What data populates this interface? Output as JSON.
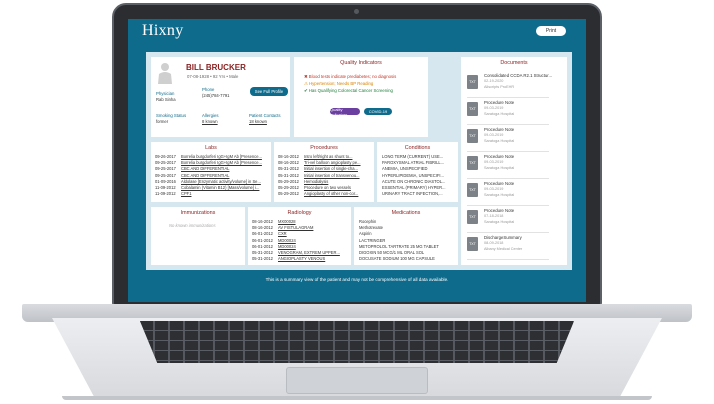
{
  "app": {
    "logo": "Hixny",
    "print_label": "Print"
  },
  "patient": {
    "name": "BILL BRUCKER",
    "meta": "07-08-1928 • 92 Yrs • Male",
    "physician_label": "Physician",
    "physician": "Rab Sinha",
    "phone_label": "Phone",
    "phone": "(245)784-7791",
    "full_profile_label": "See Full Profile",
    "smoking_label": "Smoking Status",
    "smoking": "former",
    "allergies_label": "Allergies",
    "allergies": "8 known",
    "contacts_label": "Patient Contacts",
    "contacts": "18 known"
  },
  "quality": {
    "title": "Quality Indicators",
    "items": [
      {
        "text": "Blood tests indicate prediabetes; no diagnosis",
        "color": "#c0392b",
        "icon": "x-icon"
      },
      {
        "text": "Hypertension; Needs BP Reading",
        "color": "#d98200",
        "icon": "warning-icon"
      },
      {
        "text": "Has Qualifying Colorectal Cancer Screening",
        "color": "#1e7d3a",
        "icon": "check-icon"
      }
    ],
    "btn_quality": "Quality Indicators",
    "btn_covid": "COVID-19"
  },
  "documents": {
    "title": "Documents",
    "items": [
      {
        "title": "Consolidated CCDA R2.1 Structur...",
        "date": "02-19-2020",
        "source": "Allscripts ProEHR"
      },
      {
        "title": "Procedure Note",
        "date": "09-03-2019",
        "source": "Saratoga Hospital"
      },
      {
        "title": "Procedure Note",
        "date": "09-03-2019",
        "source": "Saratoga Hospital"
      },
      {
        "title": "Procedure Note",
        "date": "09-03-2019",
        "source": "Saratoga Hospital"
      },
      {
        "title": "Procedure Note",
        "date": "09-03-2019",
        "source": "Saratoga Hospital"
      },
      {
        "title": "Procedure Note",
        "date": "07-18-2018",
        "source": "Saratoga Hospital"
      },
      {
        "title": "DischargeSummary",
        "date": "08-09-2018",
        "source": "Albany Medical Center"
      }
    ],
    "icon_text": "TXT"
  },
  "labs": {
    "title": "Labs",
    "rows": [
      {
        "date": "09-26-2017",
        "text": "Borrelia burgdorferi IgG+IgM Ab [Presence..."
      },
      {
        "date": "09-25-2017",
        "text": "Borrelia burgdorferi IgG+IgM Ab [Presence..."
      },
      {
        "date": "09-25-2017",
        "text": "CBC AND DIFFERENTIAL"
      },
      {
        "date": "09-25-2017",
        "text": "CBC AND DIFFERENTIAL"
      },
      {
        "date": "01-09-2016",
        "text": "Aldolase [Enzymatic activity/volume] in Se..."
      },
      {
        "date": "11-09-2012",
        "text": "Cobalamin (Vitamin B12) [Mass/volume] i..."
      },
      {
        "date": "11-09-2012",
        "text": "CPF1"
      }
    ]
  },
  "procedures": {
    "title": "Procedures",
    "rows": [
      {
        "date": "08-16-2012",
        "text": "Intro left/right as shunt to... "
      },
      {
        "date": "08-16-2012",
        "text": "Tri-vel balloon angioplasty pe..."
      },
      {
        "date": "05-31-2012",
        "text": "Initial insertion of single-cha..."
      },
      {
        "date": "05-31-2012",
        "text": "Initial insertion of transvenou..."
      },
      {
        "date": "05-29-2012",
        "text": "Hemodialysis"
      },
      {
        "date": "05-29-2012",
        "text": "Procedure on two vessels"
      },
      {
        "date": "05-29-2012",
        "text": "Angioplasty of other non-cor..."
      }
    ]
  },
  "conditions": {
    "title": "Conditions",
    "rows": [
      "LONG TERM (CURRENT) USE...",
      "PAROXYSMAL ATRIAL FIBRILL...",
      "ANEMIA, UNSPECIFIED",
      "HYPERLIPIDEMIA, UNSPECIFI...",
      "ACUTE ON CHRONIC DIASTOL...",
      "ESSENTIAL (PRIMARY) HYPER...",
      "URINARY TRACT INFECTION,..."
    ]
  },
  "immunizations": {
    "title": "Immunizations",
    "empty": "No known immunizations"
  },
  "radiology": {
    "title": "Radiology",
    "rows": [
      {
        "date": "08-16-2012",
        "text": "MX00028"
      },
      {
        "date": "08-16-2012",
        "text": "AV FISTULAGRAM"
      },
      {
        "date": "06-01-2012",
        "text": "CXR"
      },
      {
        "date": "06-01-2012",
        "text": "MD00024"
      },
      {
        "date": "06-01-2012",
        "text": "MD00024"
      },
      {
        "date": "05-31-2012",
        "text": "VENOGRAM, EXTREM UPPER..."
      },
      {
        "date": "05-31-2012",
        "text": "ANGIOPLASTY VENOUS"
      }
    ]
  },
  "medications": {
    "title": "Medications",
    "rows": [
      "Rocephin",
      "Methotrexate",
      "Aspirin",
      "LACTRINGER",
      "METOPROLOL TARTRATE 25 MG TABLET",
      "DIGOXIN 50 MCG/1 ML ORAL SOL",
      "DOCUSATE SODIUM 100 MG CAPSULE"
    ]
  },
  "footer": {
    "disclaimer": "This is a summary view of the patient and may not be comprehensive of all data available."
  },
  "colors": {
    "brand": "#0f6b8c",
    "title": "#8a1f1f",
    "purple_btn": "#6b3fa0",
    "teal_btn": "#0f6b8c"
  }
}
